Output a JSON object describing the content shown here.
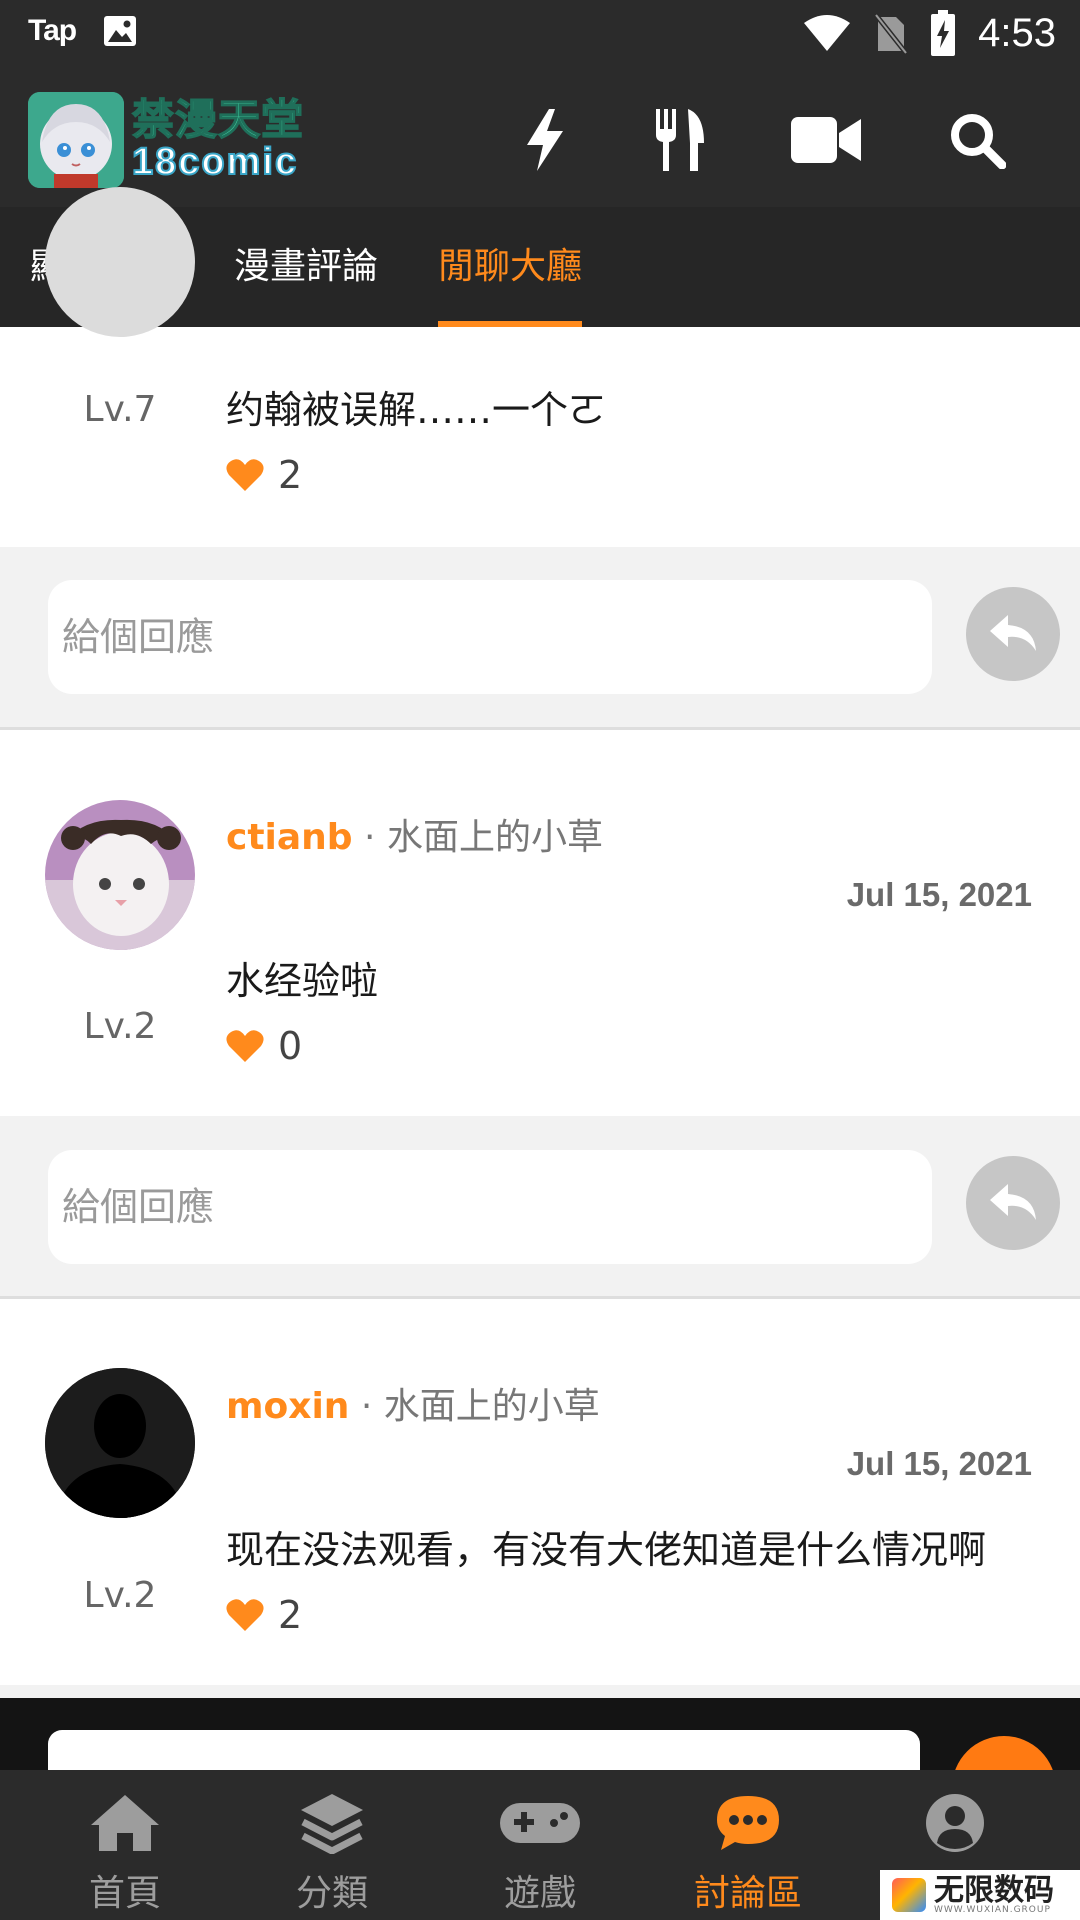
{
  "status_bar": {
    "app_label": "Tap",
    "time": "4:53"
  },
  "app_bar": {
    "logo_cn": "禁漫天堂",
    "logo_en": "18comic",
    "icons": [
      "bolt-icon",
      "utensils-icon",
      "video-icon",
      "search-icon"
    ]
  },
  "tabs": [
    {
      "label": "顯示全部",
      "active": false
    },
    {
      "label": "漫畫評論",
      "active": false
    },
    {
      "label": "閒聊大廳",
      "active": true
    }
  ],
  "feed": {
    "reply_placeholder": "給個回應",
    "comments": [
      {
        "level": "Lv.7",
        "text": "约翰被误解……一个ㄛ",
        "likes": "2"
      },
      {
        "username": "ctianb",
        "separator": " · ",
        "forum": "水面上的小草",
        "date": "Jul 15, 2021",
        "level": "Lv.2",
        "text": "水经验啦",
        "likes": "0"
      },
      {
        "username": "moxin",
        "separator": " · ",
        "forum": "水面上的小草",
        "date": "Jul 15, 2021",
        "level": "Lv.2",
        "text": "现在没法观看，有没有大佬知道是什么情况啊",
        "likes": "2"
      }
    ]
  },
  "bottom_nav": [
    {
      "label": "首頁",
      "icon": "home-icon",
      "active": false
    },
    {
      "label": "分類",
      "icon": "layers-icon",
      "active": false
    },
    {
      "label": "遊戲",
      "icon": "gamepad-icon",
      "active": false
    },
    {
      "label": "討論區",
      "icon": "chat-icon",
      "active": true
    },
    {
      "label": "",
      "icon": "user-icon",
      "active": false
    }
  ],
  "watermark": {
    "cn": "无限数码",
    "en": "WWW.WUXIAN.GROUP"
  },
  "colors": {
    "accent": "#ff8a1c",
    "bar": "#2b2b2b",
    "tabs_bg": "#262626",
    "reply_button": "#c6c6c6"
  }
}
